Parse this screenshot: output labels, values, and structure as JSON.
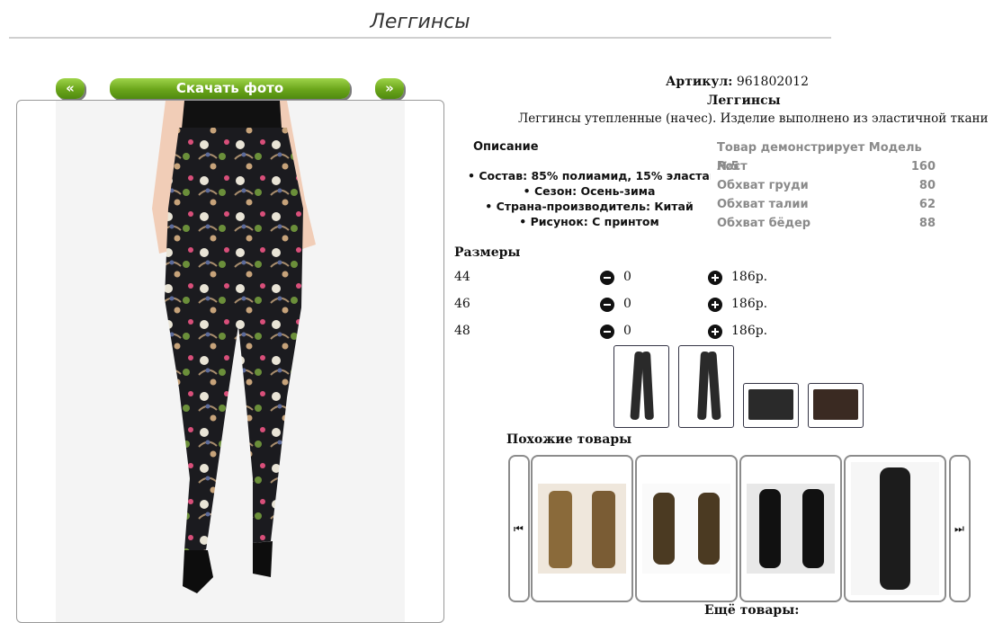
{
  "page": {
    "title": "Леггинсы"
  },
  "gallery": {
    "prev_label": "«",
    "download_label": "Скачать фото",
    "next_label": "»"
  },
  "product": {
    "sku_label": "Артикул:",
    "sku": "961802012",
    "name": "Леггинсы",
    "short_description": "Леггинсы утепленные (начес). Изделие выполнено из эластичной ткани"
  },
  "description": {
    "title": "Описание",
    "items": [
      "Состав: 85% полиамид, 15% эластан",
      "Сезон: Осень-зима",
      "Страна-производитель: Китай",
      "Рисунок: С принтом"
    ]
  },
  "model": {
    "header": "Товар демонстрирует Модель №5",
    "rows": [
      {
        "label": "Рост",
        "value": "160"
      },
      {
        "label": "Обхват груди",
        "value": "80"
      },
      {
        "label": "Обхват талии",
        "value": "62"
      },
      {
        "label": "Обхват бёдер",
        "value": "88"
      }
    ]
  },
  "sizes": {
    "title": "Размеры",
    "rows": [
      {
        "size": "44",
        "qty": "0",
        "price": "186р."
      },
      {
        "size": "46",
        "qty": "0",
        "price": "186р."
      },
      {
        "size": "48",
        "qty": "0",
        "price": "186р."
      }
    ]
  },
  "similar": {
    "title": "Похожие товары"
  },
  "more": {
    "label": "Ещё товары:"
  },
  "icons": {
    "minus": "minus-circle-icon",
    "plus": "plus-circle-icon",
    "carousel_prev": "skip-back-icon",
    "carousel_next": "skip-forward-icon"
  },
  "colors": {
    "button_green": "#6aa51a",
    "model_text": "#8a8a8a"
  }
}
